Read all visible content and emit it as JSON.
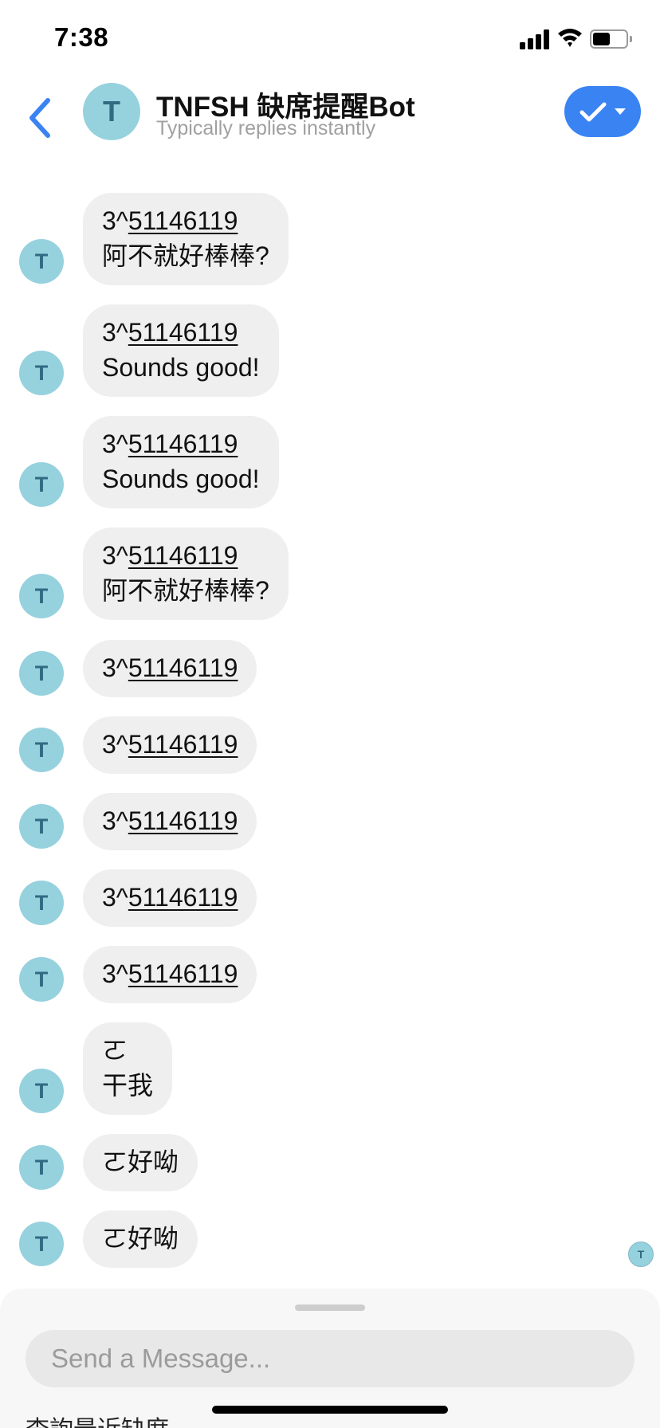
{
  "status_bar": {
    "time": "7:38"
  },
  "header": {
    "title": "TNFSH 缺席提醒Bot",
    "subtitle": "Typically replies instantly",
    "avatar_letter": "T",
    "accent_color": "#3a83f3",
    "icons": [
      "chevron-left-icon",
      "checkmark-icon",
      "caret-down-icon"
    ]
  },
  "messages": [
    {
      "avatar_letter": "T",
      "lines": [
        {
          "prefix": "",
          "number": "",
          "text": "干我"
        }
      ]
    },
    {
      "avatar_letter": "T",
      "lines": [
        {
          "prefix": "3^",
          "number": "51146119",
          "text": ""
        },
        {
          "prefix": "",
          "number": "",
          "text": "阿不就好棒棒?"
        }
      ]
    },
    {
      "avatar_letter": "T",
      "lines": [
        {
          "prefix": "3^",
          "number": "51146119",
          "text": ""
        },
        {
          "prefix": "",
          "number": "",
          "text": "Sounds good!"
        }
      ]
    },
    {
      "avatar_letter": "T",
      "lines": [
        {
          "prefix": "3^",
          "number": "51146119",
          "text": ""
        },
        {
          "prefix": "",
          "number": "",
          "text": "Sounds good!"
        }
      ]
    },
    {
      "avatar_letter": "T",
      "lines": [
        {
          "prefix": "3^",
          "number": "51146119",
          "text": ""
        },
        {
          "prefix": "",
          "number": "",
          "text": "阿不就好棒棒?"
        }
      ]
    },
    {
      "avatar_letter": "T",
      "lines": [
        {
          "prefix": "3^",
          "number": "51146119",
          "text": ""
        }
      ]
    },
    {
      "avatar_letter": "T",
      "lines": [
        {
          "prefix": "3^",
          "number": "51146119",
          "text": ""
        }
      ]
    },
    {
      "avatar_letter": "T",
      "lines": [
        {
          "prefix": "3^",
          "number": "51146119",
          "text": ""
        }
      ]
    },
    {
      "avatar_letter": "T",
      "lines": [
        {
          "prefix": "3^",
          "number": "51146119",
          "text": ""
        }
      ]
    },
    {
      "avatar_letter": "T",
      "lines": [
        {
          "prefix": "3^",
          "number": "51146119",
          "text": ""
        }
      ]
    },
    {
      "avatar_letter": "T",
      "lines": [
        {
          "prefix": "",
          "number": "",
          "text": "ㄛ"
        },
        {
          "prefix": "",
          "number": "",
          "text": "干我"
        }
      ]
    },
    {
      "avatar_letter": "T",
      "lines": [
        {
          "prefix": "",
          "number": "",
          "text": "ㄛ好呦"
        }
      ]
    },
    {
      "avatar_letter": "T",
      "lines": [
        {
          "prefix": "",
          "number": "",
          "text": "ㄛ好呦"
        }
      ]
    }
  ],
  "seen_indicator": {
    "letter": "T"
  },
  "composer": {
    "placeholder": "Send a Message...",
    "quick_reply": "查詢最近缺席"
  }
}
